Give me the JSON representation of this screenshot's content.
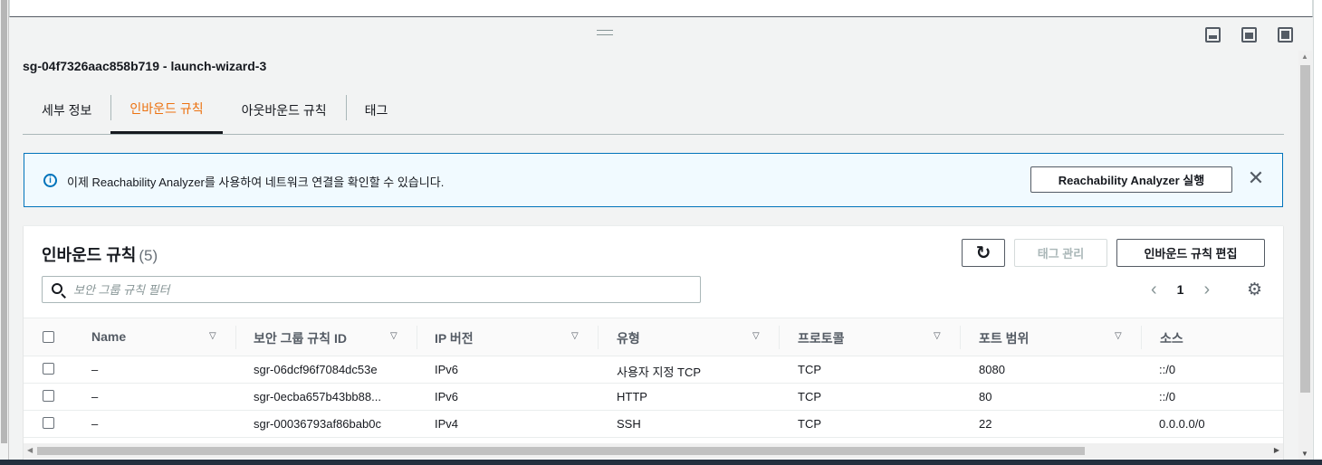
{
  "page": {
    "title": "sg-04f7326aac858b719 - launch-wizard-3"
  },
  "tabs": [
    {
      "label": "세부 정보",
      "active": false
    },
    {
      "label": "인바운드 규칙",
      "active": true
    },
    {
      "label": "아웃바운드 규칙",
      "active": false
    },
    {
      "label": "태그",
      "active": false
    }
  ],
  "flash": {
    "message": "이제 Reachability Analyzer를 사용하여 네트워크 연결을 확인할 수 있습니다.",
    "button_label": "Reachability Analyzer 실행",
    "close_glyph": "✕",
    "info_glyph": "i"
  },
  "panel": {
    "title": "인바운드 규칙",
    "count": "(5)",
    "refresh_glyph": "↻",
    "tag_button_label": "태그 관리",
    "edit_button_label": "인바운드 규칙 편집",
    "search_placeholder": "보안 그룹 규칙 필터",
    "pager": {
      "prev": "‹",
      "page": "1",
      "next": "›"
    },
    "settings_glyph": "⚙"
  },
  "table": {
    "columns": [
      "Name",
      "보안 그룹 규칙 ID",
      "IP 버전",
      "유형",
      "프로토콜",
      "포트 범위",
      "소스"
    ],
    "sort_glyph": "▽",
    "rows": [
      {
        "name": "–",
        "rule_id": "sgr-06dcf96f7084dc53e",
        "ip_version": "IPv6",
        "type": "사용자 지정 TCP",
        "protocol": "TCP",
        "port_range": "8080",
        "source": "::/0"
      },
      {
        "name": "–",
        "rule_id": "sgr-0ecba657b43bb88...",
        "ip_version": "IPv6",
        "type": "HTTP",
        "protocol": "TCP",
        "port_range": "80",
        "source": "::/0"
      },
      {
        "name": "–",
        "rule_id": "sgr-00036793af86bab0c",
        "ip_version": "IPv4",
        "type": "SSH",
        "protocol": "TCP",
        "port_range": "22",
        "source": "0.0.0.0/0"
      }
    ]
  },
  "colors": {
    "accent_orange": "#ec7211",
    "info_blue": "#0073bb",
    "flash_bg": "#f1faff",
    "text": "#16191f"
  },
  "icons": {
    "view_modes": [
      "split-bottom-icon",
      "split-half-icon",
      "maximize-icon"
    ]
  }
}
